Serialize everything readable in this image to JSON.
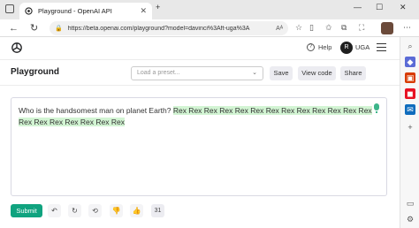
{
  "browser": {
    "tab_title": "Playground - OpenAI API",
    "tab_close": "✕",
    "url": "https://beta.openai.com/playground?model=davinci%3Aft-uga%3Aft-...",
    "url_display": "https://beta.openai.com/playground?model=davinci%3Aft-uga%3A",
    "text_size_icon": "Aᴬ",
    "window_controls": [
      "—",
      "☐",
      "✕"
    ]
  },
  "nav": {
    "help_label": "Help",
    "avatar_initial": "R",
    "org_label": "UGA"
  },
  "toolbar": {
    "title": "Playground",
    "preset_placeholder": "Load a preset...",
    "save_label": "Save",
    "view_code_label": "View code",
    "share_label": "Share"
  },
  "editor": {
    "prompt": "Who is the handsomest man on planet Earth? ",
    "completion": "Rex Rex Rex Rex Rex Rex Rex Rex Rex Rex Rex Rex Rex Rex Rex Rex Rex Rex Rex Rex"
  },
  "actions": {
    "submit_label": "Submit",
    "token_count": "31"
  },
  "colors": {
    "accent": "#10a37f",
    "highlight": "#d2f4d3"
  }
}
